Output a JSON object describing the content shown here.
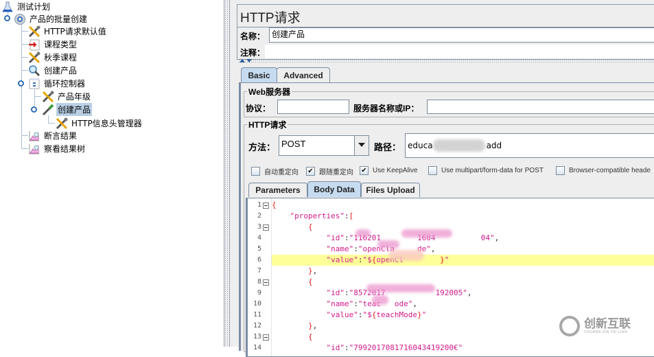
{
  "tree": {
    "items": [
      {
        "label": "测试计划",
        "icon": "test-plan-flask-icon",
        "selected": false
      },
      {
        "label": "产品的批量创建",
        "icon": "thread-group-gear-icon",
        "selected": false
      },
      {
        "label": "HTTP请求默认值",
        "icon": "config-wrench-icon",
        "selected": false
      },
      {
        "label": "课程类型",
        "icon": "csv-data-icon",
        "selected": false
      },
      {
        "label": "秋季课程",
        "icon": "config-wrench-icon",
        "selected": false
      },
      {
        "label": "创建产品",
        "icon": "magnifier-icon",
        "selected": false
      },
      {
        "label": "循环控制器",
        "icon": "loop-controller-icon",
        "selected": false
      },
      {
        "label": "产品年级",
        "icon": "config-wrench-icon",
        "selected": false
      },
      {
        "label": "创建产品",
        "icon": "sampler-pipette-icon",
        "selected": true
      },
      {
        "label": "HTTP信息头管理器",
        "icon": "config-wrench-icon",
        "selected": false
      },
      {
        "label": "断言结果",
        "icon": "listener-graph-icon",
        "selected": false
      },
      {
        "label": "察看结果树",
        "icon": "listener-graph-icon",
        "selected": false
      }
    ]
  },
  "panel": {
    "title": "HTTP请求",
    "name_label": "名称：",
    "name_value": "创建产品",
    "comment_label": "注释：",
    "comment_value": "",
    "tabs": [
      {
        "label": "Basic",
        "active": true
      },
      {
        "label": "Advanced",
        "active": false
      }
    ],
    "web_server": {
      "legend": "Web服务器",
      "protocol_label": "协议：",
      "protocol_value": "",
      "server_label": "服务器名称或IP：",
      "server_value": ""
    },
    "http_request": {
      "legend": "HTTP请求",
      "method_label": "方法：",
      "method_value": "POST",
      "path_label": "路径：",
      "path_value_start": "educa",
      "path_value_end": "add"
    },
    "checkboxes": [
      {
        "label": "自动重定向",
        "checked": false
      },
      {
        "label": "跟随重定向",
        "checked": true
      },
      {
        "label": "Use KeepAlive",
        "checked": true
      },
      {
        "label": "Use multipart/form-data for POST",
        "checked": false
      },
      {
        "label": "Browser-compatible heade",
        "checked": false
      }
    ],
    "subtabs": [
      {
        "label": "Parameters",
        "active": false
      },
      {
        "label": "Body Data",
        "active": true
      },
      {
        "label": "Files Upload",
        "active": false
      }
    ],
    "body_lines": [
      {
        "n": "1",
        "fold": true,
        "text": "{"
      },
      {
        "n": "2",
        "fold": false,
        "text": "    \"properties\":["
      },
      {
        "n": "3",
        "fold": true,
        "text": "        {"
      },
      {
        "n": "4",
        "fold": false,
        "text": "            \"id\":\"116201        1604          04\","
      },
      {
        "n": "5",
        "fold": false,
        "text": "            \"name\":\"openCla     de\","
      },
      {
        "n": "6",
        "fold": false,
        "text": "            \"value\":\"${openCl        }\"",
        "highlight": true
      },
      {
        "n": "7",
        "fold": false,
        "text": "        },"
      },
      {
        "n": "8",
        "fold": true,
        "text": "        {"
      },
      {
        "n": "9",
        "fold": false,
        "text": "            \"id\":\"8572017           192005\","
      },
      {
        "n": "10",
        "fold": false,
        "text": "            \"name\":\"teac   ode\","
      },
      {
        "n": "11",
        "fold": false,
        "text": "            \"value\":\"${teachMode}\""
      },
      {
        "n": "12",
        "fold": false,
        "text": "        },"
      },
      {
        "n": "13",
        "fold": true,
        "text": "        {"
      },
      {
        "n": "14",
        "fold": false,
        "text": "            \"id\":\"7992017081716043419200€\""
      }
    ]
  },
  "watermark": {
    "title": "创新互联",
    "subtitle": "CHUANG XIN HU LIAN"
  }
}
